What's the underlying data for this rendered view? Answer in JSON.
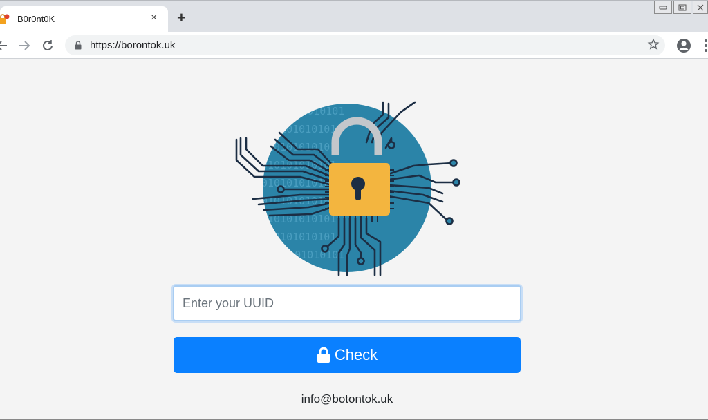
{
  "browser": {
    "tab": {
      "title": "B0r0nt0K",
      "close_label": "×"
    },
    "new_tab_label": "+",
    "address_bar": {
      "url": "https://borontok.uk"
    },
    "colors": {
      "tabstrip": "#dee1e6",
      "toolbar": "#ffffff",
      "omnibox": "#f1f3f4"
    }
  },
  "page": {
    "hero_illustration": "padlock-circuit",
    "uuid_input": {
      "value": "",
      "placeholder": "Enter your UUID"
    },
    "check_button": {
      "label": "Check"
    },
    "contact_email": "info@botontok.uk",
    "binary_text": "010101010101",
    "colors": {
      "accent": "#0a80ff",
      "circle": "#2b84a8",
      "padlock": "#f3b53f",
      "circuit": "#1c2e44",
      "background": "#f4f4f4"
    }
  }
}
